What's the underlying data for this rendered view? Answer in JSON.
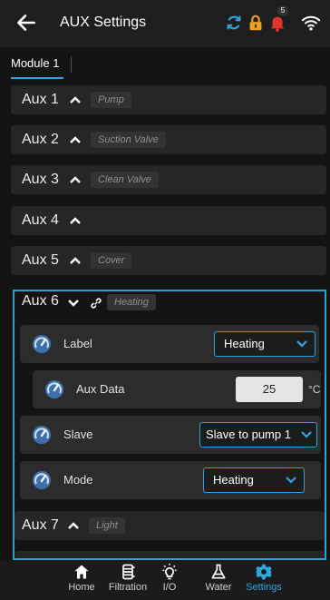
{
  "header": {
    "title": "AUX Settings",
    "notification_count": "5",
    "icons": [
      "back-arrow-icon",
      "sync-icon",
      "lock-icon",
      "bell-icon",
      "wifi-icon"
    ],
    "colors": {
      "sync": "#2fa6e0",
      "lock": "#f0a020",
      "bell": "#e0332a",
      "accent": "#29a3dc"
    }
  },
  "tabs": [
    {
      "label": "Module 1"
    }
  ],
  "aux_rows": [
    {
      "label": "Aux 1",
      "chip": "Pump"
    },
    {
      "label": "Aux 2",
      "chip": "Suction Valve"
    },
    {
      "label": "Aux 3",
      "chip": "Clean Valve"
    },
    {
      "label": "Aux 4",
      "chip": ""
    },
    {
      "label": "Aux 5",
      "chip": "Cover"
    }
  ],
  "expanded": {
    "label": "Aux 6",
    "chip": "Heating",
    "fields": {
      "label": {
        "name": "Label",
        "value": "Heating"
      },
      "aux_data": {
        "name": "Aux Data",
        "value": "25",
        "unit": "°C"
      },
      "slave": {
        "name": "Slave",
        "value": "Slave to pump 1"
      },
      "mode": {
        "name": "Mode",
        "value": "Heating"
      }
    }
  },
  "aux7": {
    "label": "Aux 7",
    "chip": "Light"
  },
  "nav": [
    {
      "label": "Home",
      "icon": "home-icon"
    },
    {
      "label": "Filtration",
      "icon": "filtration-icon"
    },
    {
      "label": "I/O",
      "icon": "lightbulb-icon"
    },
    {
      "label": "Water",
      "icon": "flask-icon"
    },
    {
      "label": "Settings",
      "icon": "gear-icon",
      "active": true
    }
  ]
}
